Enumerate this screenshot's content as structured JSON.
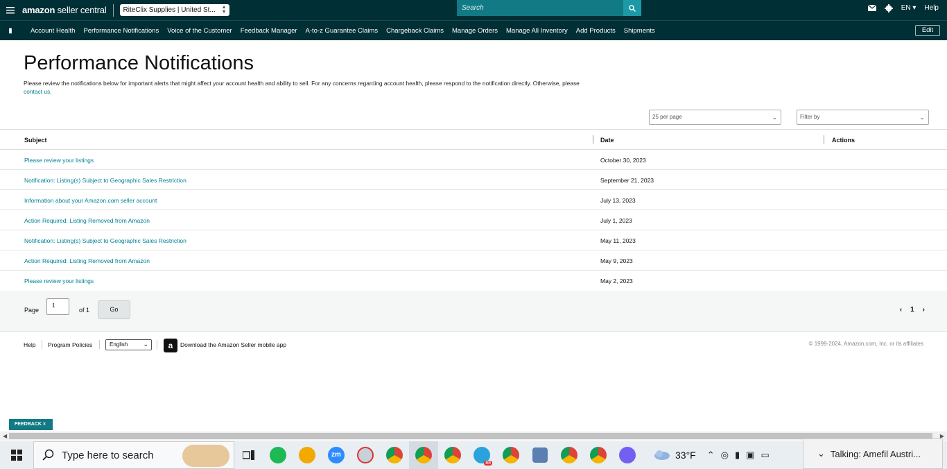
{
  "topbar": {
    "logo_brand": "amazon",
    "logo_rest": "seller central",
    "store_selector": "RiteClix Supplies | United St...",
    "search_placeholder": "Search",
    "language": "EN",
    "help": "Help"
  },
  "nav": {
    "items": [
      "Account Health",
      "Performance Notifications",
      "Voice of the Customer",
      "Feedback Manager",
      "A-to-z Guarantee Claims",
      "Chargeback Claims",
      "Manage Orders",
      "Manage All Inventory",
      "Add Products",
      "Shipments"
    ],
    "edit": "Edit"
  },
  "page": {
    "title": "Performance Notifications",
    "intro": "Please review the notifications below for important alerts that might affect your account health and ability to sell. For any concerns regarding account health, please respond to the notification directly. Otherwise, please",
    "intro_link": "contact us."
  },
  "controls": {
    "per_page": "25 per page",
    "filter": "Filter by"
  },
  "table": {
    "headers": {
      "subject": "Subject",
      "date": "Date",
      "actions": "Actions"
    },
    "rows": [
      {
        "subject": "Please review your listings",
        "date": "October 30, 2023"
      },
      {
        "subject": "Notification: Listing(s) Subject to Geographic Sales Restriction",
        "date": "September 21, 2023"
      },
      {
        "subject": "Information about your Amazon.com seller account",
        "date": "July 13, 2023"
      },
      {
        "subject": "Action Required: Listing Removed from Amazon",
        "date": "July 1, 2023"
      },
      {
        "subject": "Notification: Listing(s) Subject to Geographic Sales Restriction",
        "date": "May 11, 2023"
      },
      {
        "subject": "Action Required: Listing Removed from Amazon",
        "date": "May 9, 2023"
      },
      {
        "subject": "Please review your listings",
        "date": "May 2, 2023"
      }
    ]
  },
  "pager": {
    "label": "Page",
    "value": "1",
    "of": "of 1",
    "go": "Go",
    "current": "1",
    "prev": "‹",
    "next": "›"
  },
  "footer": {
    "help": "Help",
    "policies": "Program Policies",
    "language": "English",
    "app_icon": "a",
    "app": "Download the Amazon Seller mobile app",
    "copyright": "© 1999-2024, Amazon.com, Inc. or its affiliates"
  },
  "feedback": "FEEDBACK ×",
  "taskbar": {
    "search": "Type here to search",
    "temperature": "33°F",
    "talking": "Talking: Amefil Austri...",
    "icons": [
      "task-view-icon",
      "spotify-icon",
      "app-icon",
      "zoom-icon",
      "snip-icon",
      "chrome-icon",
      "chrome-profile-l-icon",
      "chrome-profile-m-icon",
      "telegram-icon",
      "chrome-profile-m2-icon",
      "calculator-icon",
      "chrome-profile-s-icon",
      "chrome-profile-r-icon",
      "viber-icon"
    ],
    "telegram_badge": "88",
    "zoom_text": "zm"
  }
}
